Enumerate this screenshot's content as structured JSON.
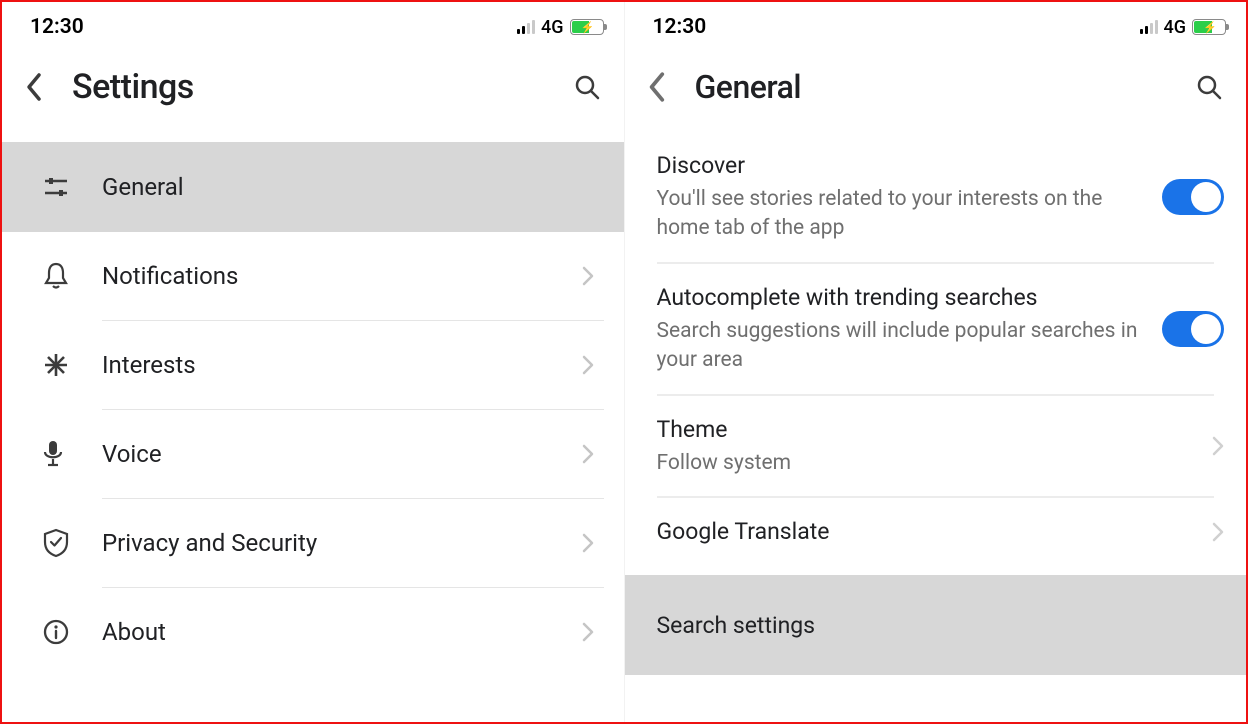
{
  "status": {
    "time": "12:30",
    "network": "4G"
  },
  "left": {
    "title": "Settings",
    "items": [
      {
        "label": "General"
      },
      {
        "label": "Notifications"
      },
      {
        "label": "Interests"
      },
      {
        "label": "Voice"
      },
      {
        "label": "Privacy and Security"
      },
      {
        "label": "About"
      }
    ]
  },
  "right": {
    "title": "General",
    "items": [
      {
        "title": "Discover",
        "sub": "You'll see stories related to your interests on the home tab of the app"
      },
      {
        "title": "Autocomplete with trending searches",
        "sub": "Search suggestions will include popular searches in your area"
      },
      {
        "title": "Theme",
        "sub": "Follow system"
      },
      {
        "title": "Google Translate"
      },
      {
        "title": "Search settings"
      }
    ]
  }
}
